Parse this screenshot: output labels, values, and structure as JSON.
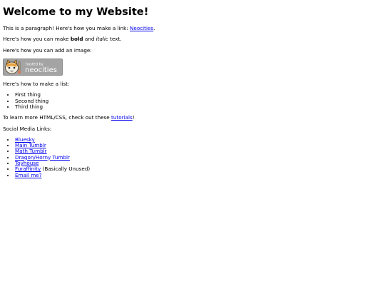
{
  "page": {
    "heading": "Welcome to my Website!",
    "intro": {
      "text_before_link": "This is a paragraph! Here's how you make a link: ",
      "link_label": "Neocities",
      "text_after_link": "."
    },
    "formatting": {
      "text_before_bold": "Here's how you can make ",
      "bold_word": "bold",
      "text_between": " and ",
      "italic_word": "italic",
      "text_after": " text."
    },
    "image_intro": "Here's how you can add an image:",
    "badge": {
      "line1": "hosted by",
      "line2": "neocities",
      "icon": "neocities-cat-logo"
    },
    "list_intro": "Here's how to make a list:",
    "list_items": [
      "First thing",
      "Second thing",
      "Third thing"
    ],
    "tutorial": {
      "text_before_link": "To learn more HTML/CSS, check out these ",
      "link_label": "tutorials",
      "text_after_link": "!"
    },
    "social_intro": "Social Media Links:",
    "social_links": [
      {
        "label": "Bluesky",
        "suffix": ""
      },
      {
        "label": "Main Tumblr",
        "suffix": ""
      },
      {
        "label": "Math Tumblr",
        "suffix": ""
      },
      {
        "label": "Dragon/Horny Tumblr",
        "suffix": ""
      },
      {
        "label": "Toyhouse",
        "suffix": ""
      },
      {
        "label": "Furaffinity",
        "suffix": " (Basically Unused)"
      },
      {
        "label": "Email me?",
        "suffix": ""
      }
    ],
    "colors": {
      "link": "#0000ee",
      "badge_bg": "#a4a4a4",
      "cat_orange": "#e8a23c"
    }
  }
}
